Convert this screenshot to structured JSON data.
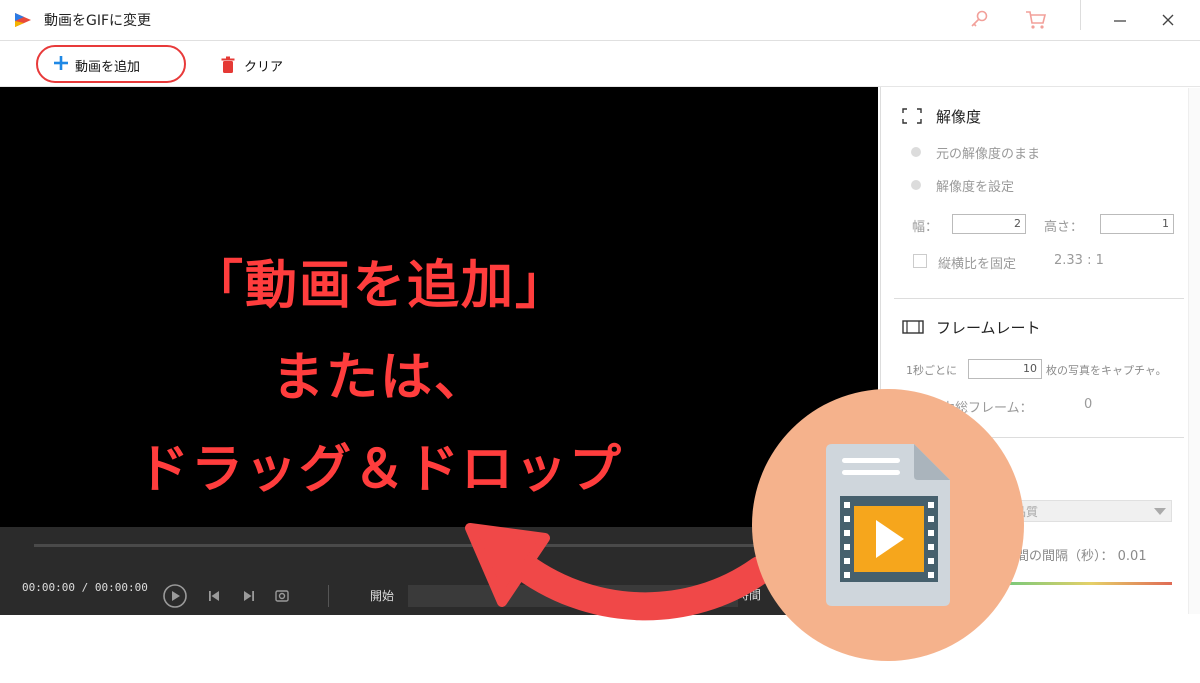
{
  "window": {
    "title": "動画をGIFに変更"
  },
  "toolbar": {
    "add_label": "動画を追加",
    "clear_label": "クリア"
  },
  "overlay": {
    "line1": "「動画を追加」",
    "line2": "または、",
    "line3": "ドラッグ＆ドロップ"
  },
  "controls": {
    "current_time": "00:00:00",
    "separator": "/",
    "total_time": "00:00:00",
    "start_label": "開始",
    "duration_label": "続時間"
  },
  "panel": {
    "resolution": {
      "title": "解像度",
      "option_keep": "元の解像度のまま",
      "option_set": "解像度を設定",
      "width_label": "幅：",
      "width_value": "2",
      "height_label": "高さ：",
      "height_value": "1",
      "aspect_label": "縦横比を固定",
      "aspect_value": "2.33 : 1"
    },
    "framerate": {
      "title": "フレームレート",
      "per_sec_label": "1秒ごとに",
      "per_sec_value": "10",
      "capture_suffix": "枚の写真をキャプチャ。",
      "total_frames_label": "力総フレーム：",
      "total_frames_value": "0"
    },
    "quality": {
      "selected": "品質",
      "interval_label": "間の間隔（秒）：",
      "interval_value": "0.01"
    }
  },
  "colors": {
    "accent_red": "#e83a3a",
    "overlay_red": "#ff3d3d",
    "blue_plus": "#1e88e5",
    "circle": "#f5b28c"
  }
}
